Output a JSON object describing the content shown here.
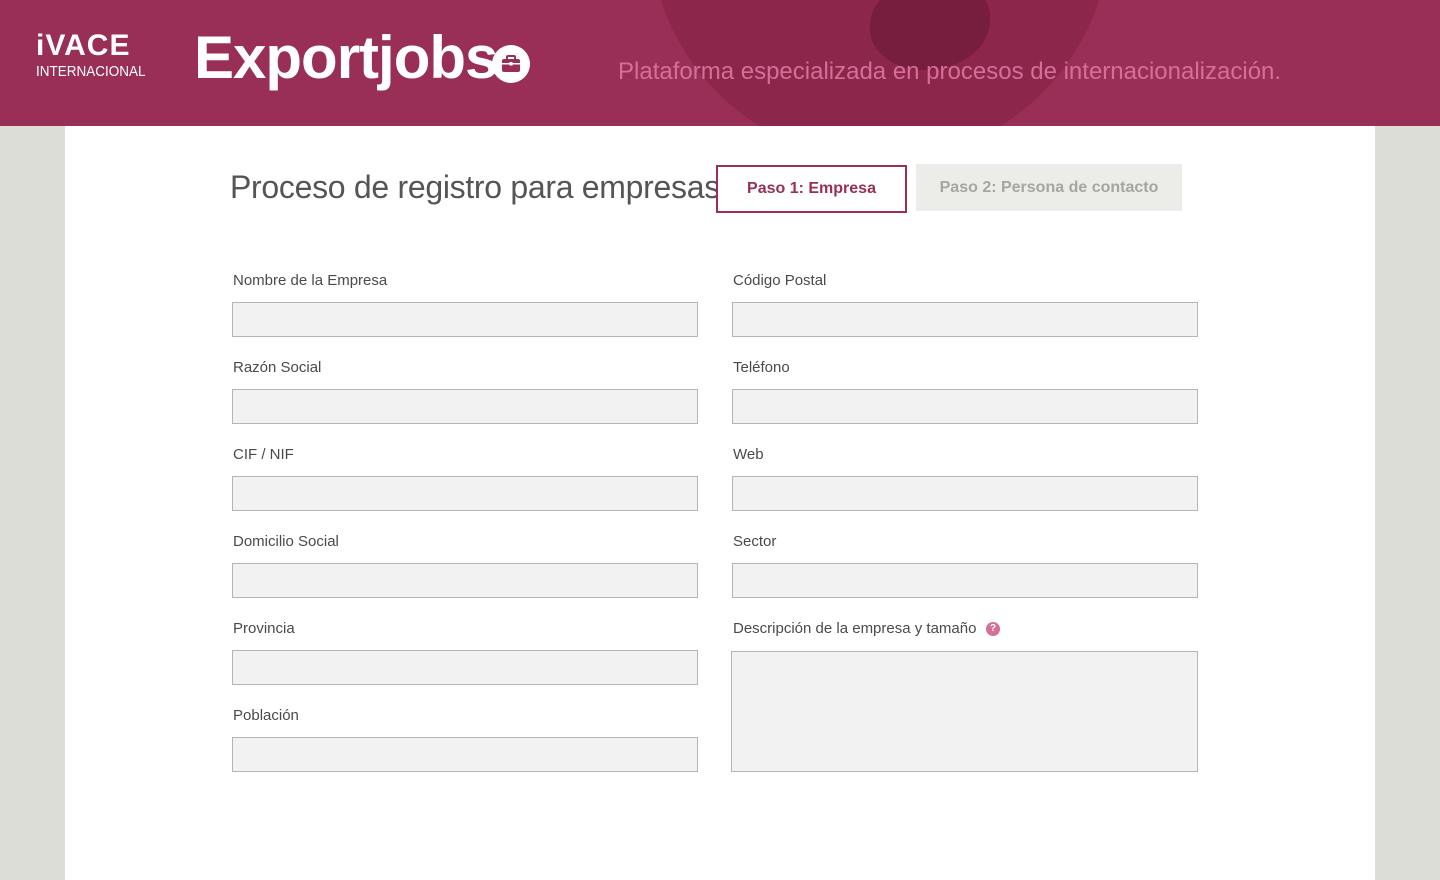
{
  "header": {
    "logo_top": "iVACE",
    "logo_bottom": "INTERNACIONAL",
    "brand": "Exportjobs",
    "tagline": "Plataforma especializada en procesos de internacionalización.",
    "brand_icon": "briefcase-icon",
    "background_color": "#992f56"
  },
  "page": {
    "title": "Proceso de registro para empresas"
  },
  "steps": [
    {
      "label": "Paso 1: Empresa",
      "active": true
    },
    {
      "label": "Paso 2: Persona de contacto",
      "active": false
    }
  ],
  "form": {
    "left": [
      {
        "label": "Nombre de la Empresa",
        "value": ""
      },
      {
        "label": "Razón Social",
        "value": ""
      },
      {
        "label": "CIF / NIF",
        "value": ""
      },
      {
        "label": "Domicilio Social",
        "value": ""
      },
      {
        "label": "Provincia",
        "value": ""
      },
      {
        "label": "Población",
        "value": ""
      }
    ],
    "right": [
      {
        "label": "Código Postal",
        "value": ""
      },
      {
        "label": "Teléfono",
        "value": ""
      },
      {
        "label": "Web",
        "value": ""
      },
      {
        "label": "Sector",
        "value": ""
      },
      {
        "label": "Descripción de la empresa y tamaño",
        "value": "",
        "help_icon": "question-mark-icon",
        "help_text": "?"
      }
    ]
  },
  "colors": {
    "accent": "#992f56",
    "tagline": "#d56f98",
    "inactive_step_bg": "#ecede8"
  }
}
